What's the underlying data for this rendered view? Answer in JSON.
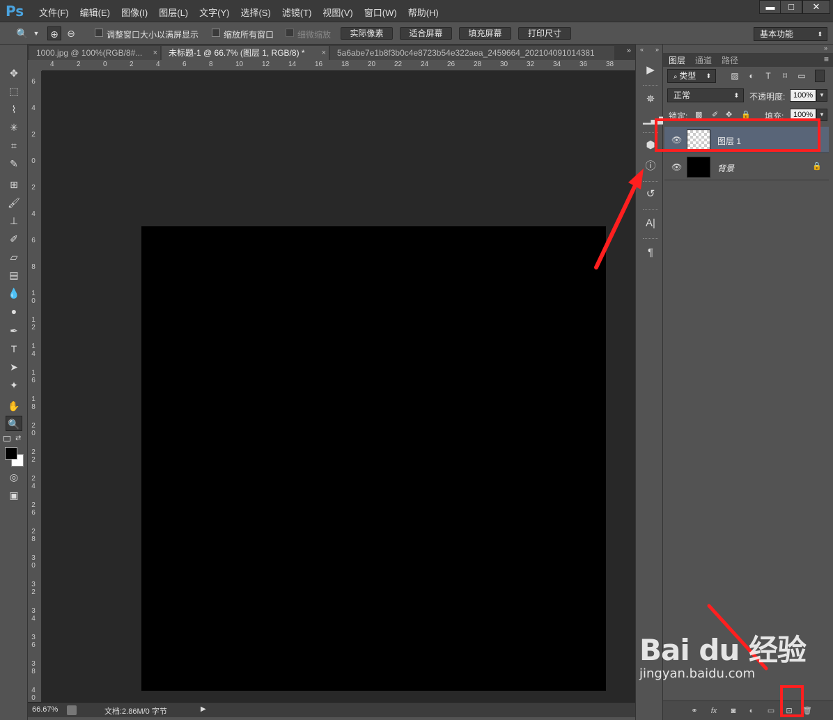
{
  "app": {
    "logo": "Ps"
  },
  "menu": [
    "文件(F)",
    "编辑(E)",
    "图像(I)",
    "图层(L)",
    "文字(Y)",
    "选择(S)",
    "滤镜(T)",
    "视图(V)",
    "窗口(W)",
    "帮助(H)"
  ],
  "window_controls": {
    "minimize": "▬",
    "maximize": "□",
    "close": "✕"
  },
  "options": {
    "resize_windows_label": "调整窗口大小以满屏显示",
    "zoom_all_label": "缩放所有窗口",
    "scrubby_zoom_label": "细微缩放",
    "actual_pixels": "实际像素",
    "fit_screen": "适合屏幕",
    "fill_screen": "填充屏幕",
    "print_size": "打印尺寸",
    "workspace": "基本功能"
  },
  "tabs": [
    {
      "label": "1000.jpg @ 100%(RGB/8#...",
      "close": "×"
    },
    {
      "label": "未标题-1 @ 66.7% (图层 1, RGB/8) *",
      "close": "×"
    },
    {
      "label": "5a6abe7e1b8f3b0c4e8723b54e322aea_2459664_202104091014381",
      "close": ""
    }
  ],
  "tabs_more": "»",
  "ruler_top": [
    "4",
    "2",
    "0",
    "2",
    "4",
    "6",
    "8",
    "10",
    "12",
    "14",
    "16",
    "18",
    "20",
    "22",
    "24",
    "26",
    "28",
    "30",
    "32",
    "34",
    "36",
    "38"
  ],
  "ruler_left": [
    "6",
    "4",
    "2",
    "0",
    "2",
    "4",
    "6",
    "8",
    "10",
    "12",
    "14",
    "16",
    "18",
    "20",
    "22",
    "24",
    "26",
    "28",
    "30",
    "32",
    "34",
    "36",
    "38",
    "40"
  ],
  "status": {
    "zoom": "66.67%",
    "doc_info": "文档:2.86M/0 字节",
    "arrow": "▶"
  },
  "layers_panel": {
    "tabs": [
      "图层",
      "通道",
      "路径"
    ],
    "filter_kind": "类型",
    "blend_mode": "正常",
    "opacity_label": "不透明度:",
    "opacity_value": "100%",
    "lock_label": "锁定:",
    "fill_label": "填充:",
    "fill_value": "100%",
    "layers": [
      {
        "name": "图层 1",
        "thumb": "transparent",
        "selected": true
      },
      {
        "name": "背景",
        "thumb": "black",
        "selected": false
      }
    ]
  },
  "watermark": {
    "main": "Bai du 经验",
    "sub": "jingyan.baidu.com"
  },
  "colors": {
    "accent_logo": "#4aa3df",
    "annotation": "#ff1f1f",
    "selected_layer": "#596578",
    "canvas": "#000000"
  }
}
